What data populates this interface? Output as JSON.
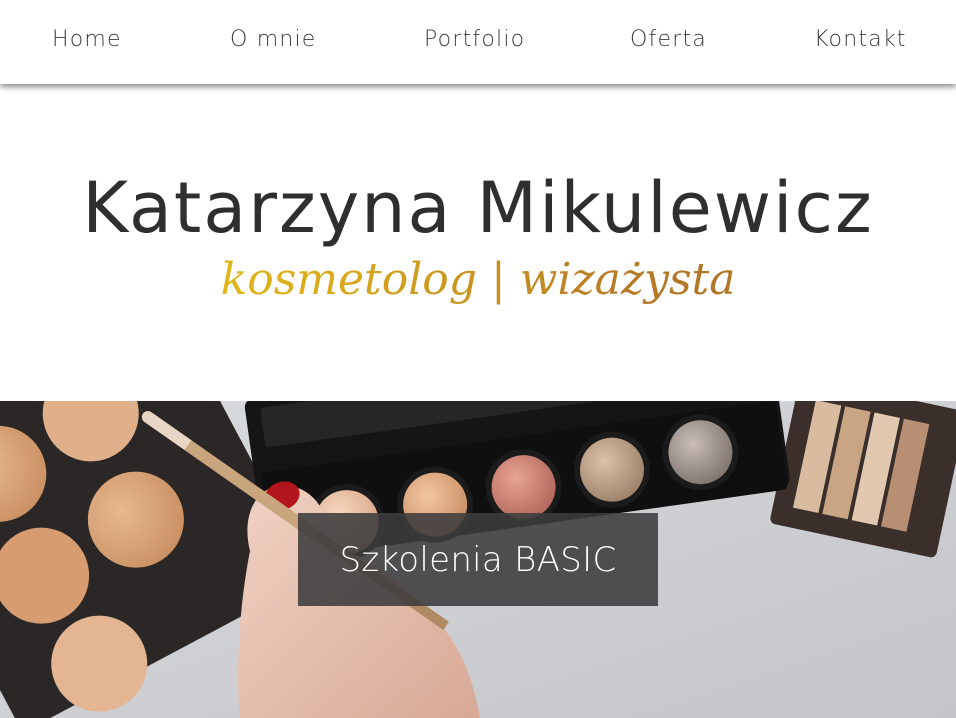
{
  "nav": {
    "items": [
      {
        "label": "Home"
      },
      {
        "label": "O mnie"
      },
      {
        "label": "Portfolio"
      },
      {
        "label": "Oferta"
      },
      {
        "label": "Kontakt"
      }
    ]
  },
  "header": {
    "name": "Katarzyna Mikulewicz",
    "tagline": "kosmetolog | wizażysta"
  },
  "hero": {
    "caption": "Szkolenia BASIC"
  },
  "colors": {
    "nav_text": "#3a3a3a",
    "title_text": "#2f2f2f",
    "tagline_gold_start": "#f0cf1a",
    "tagline_gold_end": "#a46a28",
    "caption_bg": "#3c3c3e"
  }
}
